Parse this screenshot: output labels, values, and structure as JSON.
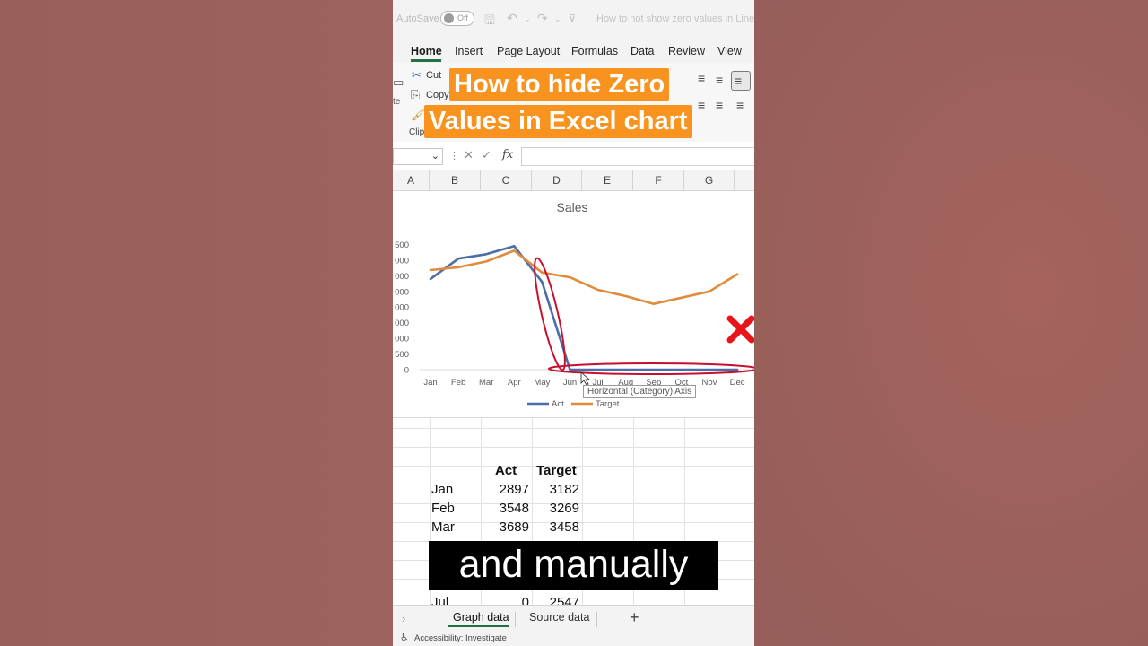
{
  "titlebar": {
    "autosave_label": "AutoSave",
    "autosave_state": "Off",
    "document_title": "How to not show zero values in Line c"
  },
  "ribbon": {
    "tabs": [
      "Home",
      "Insert",
      "Page Layout",
      "Formulas",
      "Data",
      "Review",
      "View"
    ],
    "clipboard": {
      "cut": "Cut",
      "copy": "Copy",
      "group_label": "Clip",
      "paste_fragment": "te"
    }
  },
  "formula_bar": {
    "fx": "fx",
    "value": ""
  },
  "columns": [
    "A",
    "B",
    "C",
    "D",
    "E",
    "F",
    "G"
  ],
  "overlay": {
    "title_line1": "How to hide Zero",
    "title_line2": "Values in Excel chart",
    "caption": "and manually"
  },
  "tooltip": "Horizontal (Category) Axis",
  "chart_data": {
    "type": "line",
    "title": "Sales",
    "categories": [
      "Jan",
      "Feb",
      "Mar",
      "Apr",
      "May",
      "Jun",
      "Jul",
      "Aug",
      "Sep",
      "Oct",
      "Nov",
      "Dec"
    ],
    "ytick_labels": [
      "0",
      "500",
      "000",
      "000",
      "000",
      "000",
      "000",
      "000",
      "500"
    ],
    "ylim": [
      0,
      4500
    ],
    "legend_position": "bottom",
    "series": [
      {
        "name": "Act",
        "color": "#4a6fa8",
        "values": [
          2897,
          3548,
          3689,
          3950,
          2800,
          0,
          0,
          0,
          0,
          0,
          0,
          0
        ]
      },
      {
        "name": "Target",
        "color": "#e08a3c",
        "values": [
          3182,
          3269,
          3458,
          3800,
          3100,
          2950,
          2550,
          2350,
          2100,
          2300,
          2500,
          3050
        ]
      }
    ]
  },
  "table": {
    "headers": [
      "Act",
      "Target"
    ],
    "rows": [
      {
        "month": "Jan",
        "act": "2897",
        "target": "3182"
      },
      {
        "month": "Feb",
        "act": "3548",
        "target": "3269"
      },
      {
        "month": "Mar",
        "act": "3689",
        "target": "3458"
      },
      {
        "month": "Jul",
        "act": "0",
        "target": "2547"
      }
    ]
  },
  "sheets": {
    "tabs": [
      "Graph data",
      "Source data"
    ],
    "active": "Graph data"
  },
  "status": {
    "accessibility": "Accessibility: Investigate"
  },
  "colors": {
    "excel_green": "#217346",
    "title_orange": "#f7931e",
    "annotation_red": "#c8102e"
  }
}
